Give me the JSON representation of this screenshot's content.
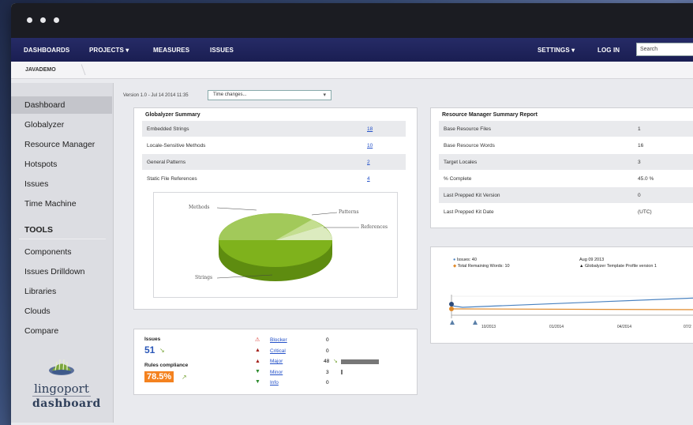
{
  "nav": {
    "items": [
      "DASHBOARDS",
      "PROJECTS",
      "MEASURES",
      "ISSUES"
    ],
    "caret": "▾",
    "settings": "SETTINGS",
    "login": "LOG IN",
    "search_placeholder": "Search"
  },
  "breadcrumb": "JAVADEMO",
  "sidebar": {
    "items": [
      "Dashboard",
      "Globalyzer",
      "Resource Manager",
      "Hotspots",
      "Issues",
      "Time Machine"
    ],
    "tools_heading": "TOOLS",
    "tools": [
      "Components",
      "Issues Drilldown",
      "Libraries",
      "Clouds",
      "Compare"
    ],
    "logo_line1": "lingoport",
    "logo_line2": "dashboard"
  },
  "version_text": "Version 1.0 - Jul 14 2014 11:35",
  "time_select": "Time changes...",
  "globalyzer": {
    "title": "Globalyzer Summary",
    "rows": [
      {
        "label": "Embedded Strings",
        "value": "18"
      },
      {
        "label": "Locale-Sensitive Methods",
        "value": "10"
      },
      {
        "label": "General Patterns",
        "value": "2"
      },
      {
        "label": "Static File References",
        "value": "4"
      }
    ],
    "pie_labels": {
      "methods": "Methods",
      "patterns": "Patterns",
      "references": "References",
      "strings": "Strings"
    }
  },
  "resource_manager": {
    "title": "Resource Manager Summary Report",
    "rows": [
      {
        "label": "Base Resource Files",
        "value": "1"
      },
      {
        "label": "Base Resource Words",
        "value": "16"
      },
      {
        "label": "Target Locales",
        "value": "3"
      },
      {
        "label": "% Complete",
        "value": "45.0 %"
      },
      {
        "label": "Last Prepped Kit Version",
        "value": "0"
      },
      {
        "label": "Last Prepped Kit Date",
        "value": "(UTC)"
      }
    ]
  },
  "issues": {
    "label": "Issues",
    "count": "51",
    "compliance_label": "Rules compliance",
    "compliance_value": "78.5%",
    "severities": [
      {
        "name": "Blocker",
        "count": "0",
        "color": "#d9342b"
      },
      {
        "name": "Critical",
        "count": "0",
        "color": "#a3221c"
      },
      {
        "name": "Major",
        "count": "48",
        "color": "#a3221c"
      },
      {
        "name": "Minor",
        "count": "3",
        "color": "#2e8b2e"
      },
      {
        "name": "Info",
        "count": "0",
        "color": "#2e8b2e"
      }
    ]
  },
  "timeline": {
    "legend": [
      "Issues: 40",
      "Total Remaining Words: 10"
    ],
    "event_date": "Aug 09 2013",
    "event_text": "Globalyzer Template Profile version 1",
    "x_ticks": [
      "10/2013",
      "01/2014",
      "04/2014",
      "07/2"
    ]
  },
  "colors": {
    "nav_bg": "#1f2460",
    "pie_green": "#7fb21c",
    "compliance": "#f4821f",
    "link": "#2350c8",
    "issues_line": "#4a82c0",
    "words_line": "#e08a2a"
  }
}
